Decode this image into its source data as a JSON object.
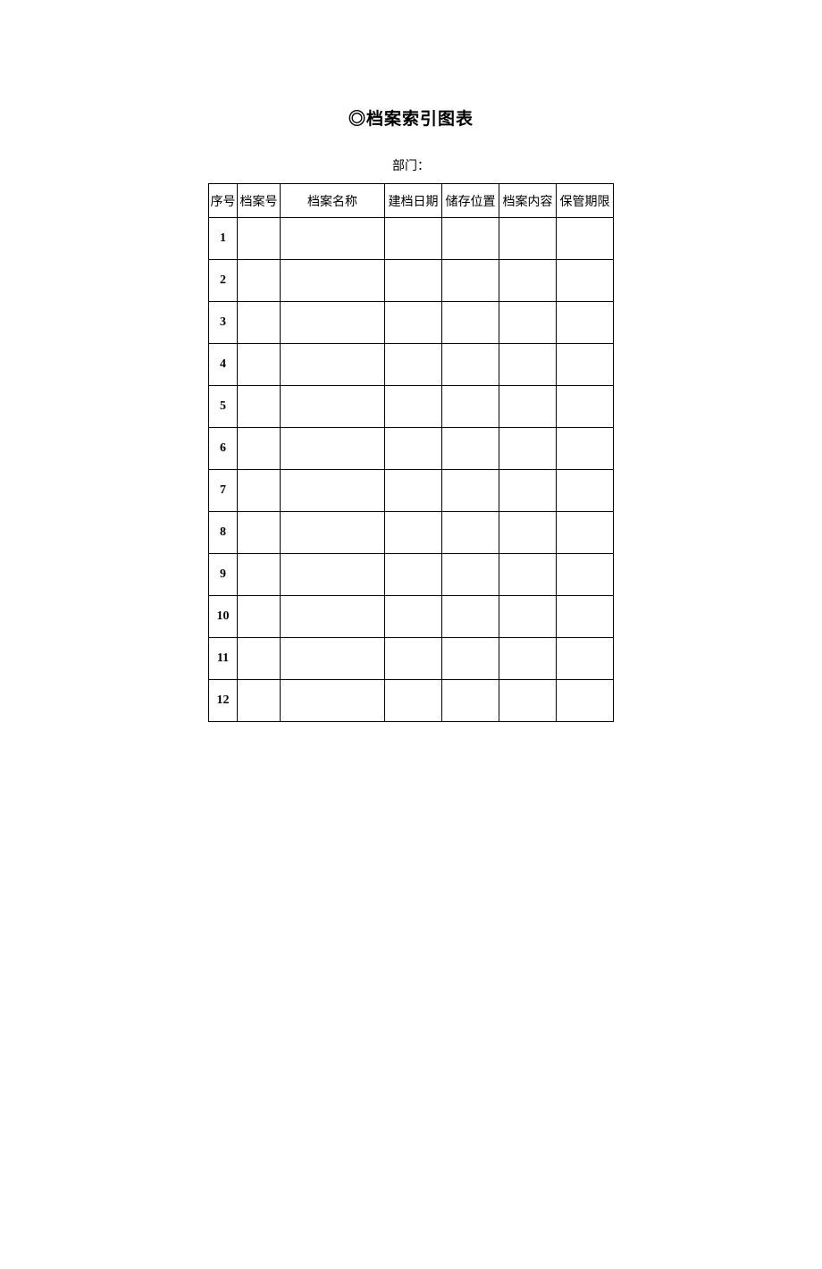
{
  "title": "◎档案索引图表",
  "department_label": "部门：",
  "headers": {
    "seq": "序号",
    "fileno": "档案号",
    "filename": "档案名称",
    "date": "建档日期",
    "location": "储存位置",
    "content": "档案内容",
    "period": "保管期限"
  },
  "rows": [
    {
      "seq": "1",
      "fileno": "",
      "filename": "",
      "date": "",
      "location": "",
      "content": "",
      "period": ""
    },
    {
      "seq": "2",
      "fileno": "",
      "filename": "",
      "date": "",
      "location": "",
      "content": "",
      "period": ""
    },
    {
      "seq": "3",
      "fileno": "",
      "filename": "",
      "date": "",
      "location": "",
      "content": "",
      "period": ""
    },
    {
      "seq": "4",
      "fileno": "",
      "filename": "",
      "date": "",
      "location": "",
      "content": "",
      "period": ""
    },
    {
      "seq": "5",
      "fileno": "",
      "filename": "",
      "date": "",
      "location": "",
      "content": "",
      "period": ""
    },
    {
      "seq": "6",
      "fileno": "",
      "filename": "",
      "date": "",
      "location": "",
      "content": "",
      "period": ""
    },
    {
      "seq": "7",
      "fileno": "",
      "filename": "",
      "date": "",
      "location": "",
      "content": "",
      "period": ""
    },
    {
      "seq": "8",
      "fileno": "",
      "filename": "",
      "date": "",
      "location": "",
      "content": "",
      "period": ""
    },
    {
      "seq": "9",
      "fileno": "",
      "filename": "",
      "date": "",
      "location": "",
      "content": "",
      "period": ""
    },
    {
      "seq": "10",
      "fileno": "",
      "filename": "",
      "date": "",
      "location": "",
      "content": "",
      "period": ""
    },
    {
      "seq": "11",
      "fileno": "",
      "filename": "",
      "date": "",
      "location": "",
      "content": "",
      "period": ""
    },
    {
      "seq": "12",
      "fileno": "",
      "filename": "",
      "date": "",
      "location": "",
      "content": "",
      "period": ""
    }
  ]
}
